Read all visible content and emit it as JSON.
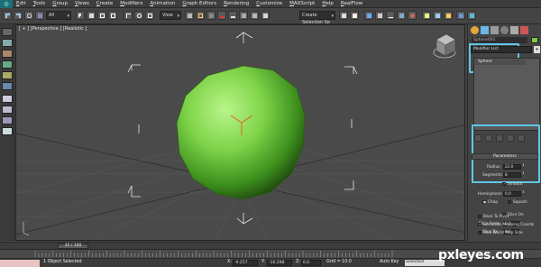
{
  "menubar": {
    "logo": "◎",
    "items": [
      "Edit",
      "Tools",
      "Group",
      "Views",
      "Create",
      "Modifiers",
      "Animation",
      "Graph Editors",
      "Rendering",
      "Customize",
      "MAXScript",
      "Help",
      "RealFlow"
    ]
  },
  "toolbar": {
    "selection_filter": "All",
    "reference_coord": "View",
    "named_selection": "Create Selection Se"
  },
  "viewport": {
    "label": "[ + ] [Perspective ] [Realistic ]",
    "object_color": "#7ec84a"
  },
  "command_panel": {
    "object_name": "Sphere001",
    "modifier_list": "Modifier List",
    "stack_item": "Sphere",
    "params_title": "Parameters",
    "radius_label": "Radius:",
    "radius_value": "22.0",
    "segments_label": "Segments:",
    "segments_value": "8",
    "smooth_label": "Smooth",
    "hemisphere_label": "Hemisphere:",
    "hemisphere_value": "0.0",
    "chop_label": "Chop",
    "squash_label": "Squash",
    "slice_on_label": "Slice On",
    "slice_from_label": "Slice From:",
    "slice_from_value": "0.0",
    "slice_to_label": "Slice To:",
    "slice_to_value": "0.0",
    "base_pivot_label": "Base To Pivot",
    "gen_mapping_label": "Generate Mapping Coords",
    "real_world_label": "Real-World Map Size",
    "highlight_color": "#5fc7e6"
  },
  "timeline": {
    "frame": "35 / 100"
  },
  "statusbar": {
    "selection_info": "1 Object Selected",
    "x_label": "X:",
    "x_value": "-9.257",
    "y_label": "Y:",
    "y_value": "-16.298",
    "z_label": "Z:",
    "z_value": "0.0",
    "grid_label": "Grid = 10.0",
    "autokey": "Auto Key",
    "selected": "Selected"
  },
  "watermark": {
    "brand": "pxleyes",
    "tld": ".com"
  }
}
